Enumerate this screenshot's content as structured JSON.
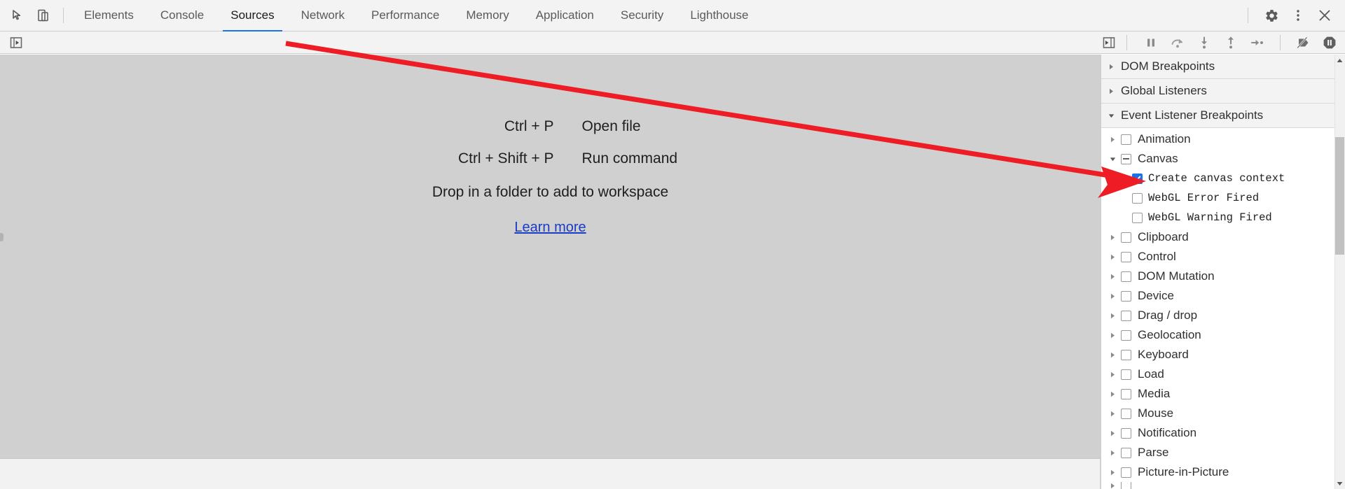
{
  "tabbar": {
    "left_icons": [
      {
        "name": "inspect-element-icon",
        "label": "Inspect element"
      },
      {
        "name": "device-toolbar-icon",
        "label": "Toggle device toolbar"
      }
    ],
    "tabs": [
      {
        "label": "Elements",
        "active": false
      },
      {
        "label": "Console",
        "active": false
      },
      {
        "label": "Sources",
        "active": true
      },
      {
        "label": "Network",
        "active": false
      },
      {
        "label": "Performance",
        "active": false
      },
      {
        "label": "Memory",
        "active": false
      },
      {
        "label": "Application",
        "active": false
      },
      {
        "label": "Security",
        "active": false
      },
      {
        "label": "Lighthouse",
        "active": false
      }
    ],
    "right_icons": [
      {
        "name": "gear-icon",
        "label": "Settings"
      },
      {
        "name": "kebab-menu-icon",
        "label": "Customize and control DevTools"
      },
      {
        "name": "close-icon",
        "label": "Close DevTools"
      }
    ],
    "active_tab_indicator_color": "#1a73e8"
  },
  "toolbar2": {
    "show_navigator_label": "Show navigator",
    "show_debugger_label": "Show debugger",
    "debugger_buttons": [
      {
        "name": "pause-script-execution-icon",
        "label": "Pause script execution"
      },
      {
        "name": "step-over-icon",
        "label": "Step over next function call"
      },
      {
        "name": "step-into-icon",
        "label": "Step into next function call"
      },
      {
        "name": "step-out-icon",
        "label": "Step out of current function"
      },
      {
        "name": "step-icon",
        "label": "Step"
      },
      {
        "name": "deactivate-breakpoints-icon",
        "label": "Deactivate breakpoints"
      },
      {
        "name": "pause-on-exceptions-icon",
        "label": "Pause on exceptions"
      }
    ]
  },
  "editor": {
    "shortcuts": [
      {
        "keys": "Ctrl + P",
        "action": "Open file"
      },
      {
        "keys": "Ctrl + Shift + P",
        "action": "Run command"
      }
    ],
    "drop_hint": "Drop in a folder to add to workspace",
    "learn_more": "Learn more",
    "link_color": "#1a3bc4",
    "background": "#d0d0d0"
  },
  "sidebar": {
    "sections": [
      {
        "label": "DOM Breakpoints",
        "expanded": false
      },
      {
        "label": "Global Listeners",
        "expanded": false
      },
      {
        "label": "Event Listener Breakpoints",
        "expanded": true
      }
    ],
    "event_listener_breakpoints": [
      {
        "label": "Animation",
        "expanded": false,
        "check": "unchecked",
        "indent": 0
      },
      {
        "label": "Canvas",
        "expanded": true,
        "check": "indeterminate",
        "indent": 0
      },
      {
        "label": "Create canvas context",
        "check": "checked",
        "indent": 1
      },
      {
        "label": "WebGL Error Fired",
        "check": "unchecked",
        "indent": 1
      },
      {
        "label": "WebGL Warning Fired",
        "check": "unchecked",
        "indent": 1
      },
      {
        "label": "Clipboard",
        "expanded": false,
        "check": "unchecked",
        "indent": 0
      },
      {
        "label": "Control",
        "expanded": false,
        "check": "unchecked",
        "indent": 0
      },
      {
        "label": "DOM Mutation",
        "expanded": false,
        "check": "unchecked",
        "indent": 0
      },
      {
        "label": "Device",
        "expanded": false,
        "check": "unchecked",
        "indent": 0
      },
      {
        "label": "Drag / drop",
        "expanded": false,
        "check": "unchecked",
        "indent": 0
      },
      {
        "label": "Geolocation",
        "expanded": false,
        "check": "unchecked",
        "indent": 0
      },
      {
        "label": "Keyboard",
        "expanded": false,
        "check": "unchecked",
        "indent": 0
      },
      {
        "label": "Load",
        "expanded": false,
        "check": "unchecked",
        "indent": 0
      },
      {
        "label": "Media",
        "expanded": false,
        "check": "unchecked",
        "indent": 0
      },
      {
        "label": "Mouse",
        "expanded": false,
        "check": "unchecked",
        "indent": 0
      },
      {
        "label": "Notification",
        "expanded": false,
        "check": "unchecked",
        "indent": 0
      },
      {
        "label": "Parse",
        "expanded": false,
        "check": "unchecked",
        "indent": 0
      },
      {
        "label": "Picture-in-Picture",
        "expanded": false,
        "check": "unchecked",
        "indent": 0
      }
    ],
    "checkbox_checked_color": "#1a73e8",
    "scrollbar": {
      "name": "vertical-scrollbar"
    }
  },
  "annotation": {
    "name": "red-arrow-annotation",
    "color": "#ee1c25",
    "points_to": "Create canvas context"
  }
}
